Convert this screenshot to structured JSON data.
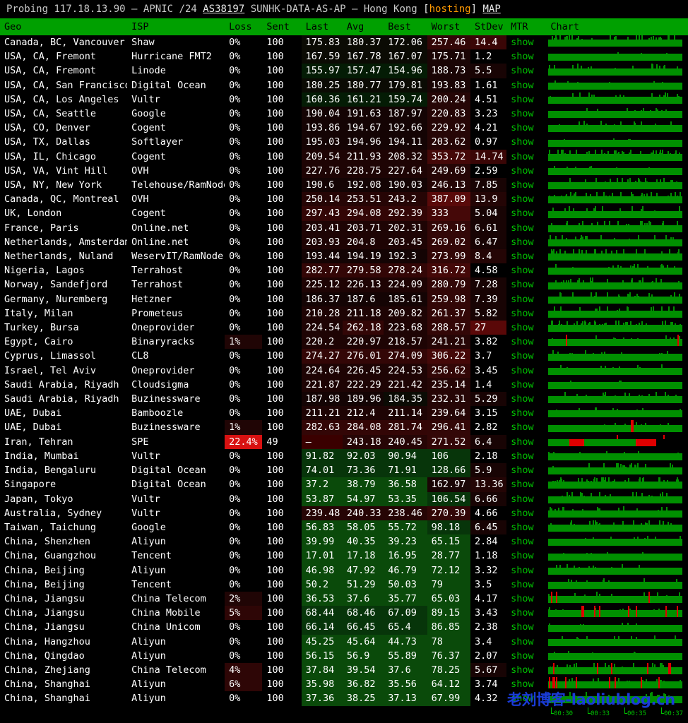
{
  "titlebar": {
    "probing_label": "Probing",
    "ip": "117.18.13.90",
    "dash1": "–",
    "registry": "APNIC",
    "prefix": "/24",
    "asn": "AS38197",
    "as_name": "SUNHK-DATA-AS-AP",
    "dash2": "–",
    "location": "Hong Kong",
    "bracket_open": "[",
    "hosting": "hosting",
    "bracket_close": "]",
    "map_link": "MAP",
    "hosting_color": "#ff9900",
    "link_color": "#e8e8e8"
  },
  "table": {
    "headers": [
      "Geo",
      "ISP",
      "Loss",
      "Sent",
      "Last",
      "Avg",
      "Best",
      "Worst",
      "StDev",
      "MTR",
      "Chart"
    ],
    "header_bg": "#00a000",
    "show_label": "show",
    "rows": [
      {
        "geo": "Canada, BC, Vancouver",
        "isp": "Shaw",
        "loss": "0%",
        "sent": "100",
        "last": "175.83",
        "avg": "180.37",
        "best": "172.06",
        "worst": "257.46",
        "stdev": "14.4",
        "mtr": "show"
      },
      {
        "geo": "USA, CA, Fremont",
        "isp": "Hurricane FMT2",
        "loss": "0%",
        "sent": "100",
        "last": "167.59",
        "avg": "167.78",
        "best": "167.07",
        "worst": "175.71",
        "stdev": "1.2",
        "mtr": "show"
      },
      {
        "geo": "USA, CA, Fremont",
        "isp": "Linode",
        "loss": "0%",
        "sent": "100",
        "last": "155.97",
        "avg": "157.47",
        "best": "154.96",
        "worst": "188.73",
        "stdev": "5.5",
        "mtr": "show"
      },
      {
        "geo": "USA, CA, San Francisco",
        "isp": "Digital Ocean",
        "loss": "0%",
        "sent": "100",
        "last": "180.25",
        "avg": "180.77",
        "best": "179.81",
        "worst": "193.83",
        "stdev": "1.61",
        "mtr": "show"
      },
      {
        "geo": "USA, CA, Los Angeles",
        "isp": "Vultr",
        "loss": "0%",
        "sent": "100",
        "last": "160.36",
        "avg": "161.21",
        "best": "159.74",
        "worst": "200.24",
        "stdev": "4.51",
        "mtr": "show"
      },
      {
        "geo": "USA, CA, Seattle",
        "isp": "Google",
        "loss": "0%",
        "sent": "100",
        "last": "190.04",
        "avg": "191.63",
        "best": "187.97",
        "worst": "220.83",
        "stdev": "3.23",
        "mtr": "show"
      },
      {
        "geo": "USA, CO, Denver",
        "isp": "Cogent",
        "loss": "0%",
        "sent": "100",
        "last": "193.86",
        "avg": "194.67",
        "best": "192.66",
        "worst": "229.92",
        "stdev": "4.21",
        "mtr": "show"
      },
      {
        "geo": "USA, TX, Dallas",
        "isp": "Softlayer",
        "loss": "0%",
        "sent": "100",
        "last": "195.03",
        "avg": "194.96",
        "best": "194.11",
        "worst": "203.62",
        "stdev": "0.97",
        "mtr": "show"
      },
      {
        "geo": "USA, IL, Chicago",
        "isp": "Cogent",
        "loss": "0%",
        "sent": "100",
        "last": "209.54",
        "avg": "211.93",
        "best": "208.32",
        "worst": "353.72",
        "stdev": "14.74",
        "mtr": "show"
      },
      {
        "geo": "USA, VA, Vint Hill",
        "isp": "OVH",
        "loss": "0%",
        "sent": "100",
        "last": "227.76",
        "avg": "228.75",
        "best": "227.64",
        "worst": "249.69",
        "stdev": "2.59",
        "mtr": "show"
      },
      {
        "geo": "USA, NY, New York",
        "isp": "Telehouse/RamNode",
        "loss": "0%",
        "sent": "100",
        "last": "190.6",
        "avg": "192.08",
        "best": "190.03",
        "worst": "246.13",
        "stdev": "7.85",
        "mtr": "show"
      },
      {
        "geo": "Canada, QC, Montreal",
        "isp": "OVH",
        "loss": "0%",
        "sent": "100",
        "last": "250.14",
        "avg": "253.51",
        "best": "243.2",
        "worst": "387.09",
        "stdev": "13.9",
        "mtr": "show"
      },
      {
        "geo": "UK, London",
        "isp": "Cogent",
        "loss": "0%",
        "sent": "100",
        "last": "297.43",
        "avg": "294.08",
        "best": "292.39",
        "worst": "333",
        "stdev": "5.04",
        "mtr": "show"
      },
      {
        "geo": "France, Paris",
        "isp": "Online.net",
        "loss": "0%",
        "sent": "100",
        "last": "203.41",
        "avg": "203.71",
        "best": "202.31",
        "worst": "269.16",
        "stdev": "6.61",
        "mtr": "show"
      },
      {
        "geo": "Netherlands, Amsterdam",
        "isp": "Online.net",
        "loss": "0%",
        "sent": "100",
        "last": "203.93",
        "avg": "204.8",
        "best": "203.45",
        "worst": "269.02",
        "stdev": "6.47",
        "mtr": "show"
      },
      {
        "geo": "Netherlands, Nuland",
        "isp": "WeservIT/RamNode",
        "loss": "0%",
        "sent": "100",
        "last": "193.44",
        "avg": "194.19",
        "best": "192.3",
        "worst": "273.99",
        "stdev": "8.4",
        "mtr": "show"
      },
      {
        "geo": "Nigeria, Lagos",
        "isp": "Terrahost",
        "loss": "0%",
        "sent": "100",
        "last": "282.77",
        "avg": "279.58",
        "best": "278.24",
        "worst": "316.72",
        "stdev": "4.58",
        "mtr": "show"
      },
      {
        "geo": "Norway, Sandefjord",
        "isp": "Terrahost",
        "loss": "0%",
        "sent": "100",
        "last": "225.12",
        "avg": "226.13",
        "best": "224.09",
        "worst": "280.79",
        "stdev": "7.28",
        "mtr": "show"
      },
      {
        "geo": "Germany, Nuremberg",
        "isp": "Hetzner",
        "loss": "0%",
        "sent": "100",
        "last": "186.37",
        "avg": "187.6",
        "best": "185.61",
        "worst": "259.98",
        "stdev": "7.39",
        "mtr": "show"
      },
      {
        "geo": "Italy, Milan",
        "isp": "Prometeus",
        "loss": "0%",
        "sent": "100",
        "last": "210.28",
        "avg": "211.18",
        "best": "209.82",
        "worst": "261.37",
        "stdev": "5.82",
        "mtr": "show"
      },
      {
        "geo": "Turkey, Bursa",
        "isp": "Oneprovider",
        "loss": "0%",
        "sent": "100",
        "last": "224.54",
        "avg": "262.18",
        "best": "223.68",
        "worst": "288.57",
        "stdev": "27",
        "mtr": "show"
      },
      {
        "geo": "Egypt, Cairo",
        "isp": "Binaryracks",
        "loss": "1%",
        "sent": "100",
        "last": "220.2",
        "avg": "220.97",
        "best": "218.57",
        "worst": "241.21",
        "stdev": "3.82",
        "mtr": "show"
      },
      {
        "geo": "Cyprus, Limassol",
        "isp": "CL8",
        "loss": "0%",
        "sent": "100",
        "last": "274.27",
        "avg": "276.01",
        "best": "274.09",
        "worst": "306.22",
        "stdev": "3.7",
        "mtr": "show"
      },
      {
        "geo": "Israel, Tel Aviv",
        "isp": "Oneprovider",
        "loss": "0%",
        "sent": "100",
        "last": "224.64",
        "avg": "226.45",
        "best": "224.53",
        "worst": "256.62",
        "stdev": "3.45",
        "mtr": "show"
      },
      {
        "geo": "Saudi Arabia, Riyadh",
        "isp": "Cloudsigma",
        "loss": "0%",
        "sent": "100",
        "last": "221.87",
        "avg": "222.29",
        "best": "221.42",
        "worst": "235.14",
        "stdev": "1.4",
        "mtr": "show"
      },
      {
        "geo": "Saudi Arabia, Riyadh",
        "isp": "Buzinessware",
        "loss": "0%",
        "sent": "100",
        "last": "187.98",
        "avg": "189.96",
        "best": "184.35",
        "worst": "232.31",
        "stdev": "5.29",
        "mtr": "show"
      },
      {
        "geo": "UAE, Dubai",
        "isp": "Bamboozle",
        "loss": "0%",
        "sent": "100",
        "last": "211.21",
        "avg": "212.4",
        "best": "211.14",
        "worst": "239.64",
        "stdev": "3.15",
        "mtr": "show"
      },
      {
        "geo": "UAE, Dubai",
        "isp": "Buzinessware",
        "loss": "1%",
        "sent": "100",
        "last": "282.63",
        "avg": "284.08",
        "best": "281.74",
        "worst": "296.41",
        "stdev": "2.82",
        "mtr": "show"
      },
      {
        "geo": "Iran, Tehran",
        "isp": "SPE",
        "loss": "22.4%",
        "sent": "49",
        "last": "–",
        "avg": "243.18",
        "best": "240.45",
        "worst": "271.52",
        "stdev": "6.4",
        "mtr": "show"
      },
      {
        "geo": "India, Mumbai",
        "isp": "Vultr",
        "loss": "0%",
        "sent": "100",
        "last": "91.82",
        "avg": "92.03",
        "best": "90.94",
        "worst": "106",
        "stdev": "2.18",
        "mtr": "show"
      },
      {
        "geo": "India, Bengaluru",
        "isp": "Digital Ocean",
        "loss": "0%",
        "sent": "100",
        "last": "74.01",
        "avg": "73.36",
        "best": "71.91",
        "worst": "128.66",
        "stdev": "5.9",
        "mtr": "show"
      },
      {
        "geo": "Singapore",
        "isp": "Digital Ocean",
        "loss": "0%",
        "sent": "100",
        "last": "37.2",
        "avg": "38.79",
        "best": "36.58",
        "worst": "162.97",
        "stdev": "13.36",
        "mtr": "show"
      },
      {
        "geo": "Japan, Tokyo",
        "isp": "Vultr",
        "loss": "0%",
        "sent": "100",
        "last": "53.87",
        "avg": "54.97",
        "best": "53.35",
        "worst": "106.54",
        "stdev": "6.66",
        "mtr": "show"
      },
      {
        "geo": "Australia, Sydney",
        "isp": "Vultr",
        "loss": "0%",
        "sent": "100",
        "last": "239.48",
        "avg": "240.33",
        "best": "238.46",
        "worst": "270.39",
        "stdev": "4.66",
        "mtr": "show"
      },
      {
        "geo": "Taiwan, Taichung",
        "isp": "Google",
        "loss": "0%",
        "sent": "100",
        "last": "56.83",
        "avg": "58.05",
        "best": "55.72",
        "worst": "98.18",
        "stdev": "6.45",
        "mtr": "show"
      },
      {
        "geo": "China, Shenzhen",
        "isp": "Aliyun",
        "loss": "0%",
        "sent": "100",
        "last": "39.99",
        "avg": "40.35",
        "best": "39.23",
        "worst": "65.15",
        "stdev": "2.84",
        "mtr": "show"
      },
      {
        "geo": "China, Guangzhou",
        "isp": "Tencent",
        "loss": "0%",
        "sent": "100",
        "last": "17.01",
        "avg": "17.18",
        "best": "16.95",
        "worst": "28.77",
        "stdev": "1.18",
        "mtr": "show"
      },
      {
        "geo": "China, Beijing",
        "isp": "Aliyun",
        "loss": "0%",
        "sent": "100",
        "last": "46.98",
        "avg": "47.92",
        "best": "46.79",
        "worst": "72.12",
        "stdev": "3.32",
        "mtr": "show"
      },
      {
        "geo": "China, Beijing",
        "isp": "Tencent",
        "loss": "0%",
        "sent": "100",
        "last": "50.2",
        "avg": "51.29",
        "best": "50.03",
        "worst": "79",
        "stdev": "3.5",
        "mtr": "show"
      },
      {
        "geo": "China, Jiangsu",
        "isp": "China Telecom",
        "loss": "2%",
        "sent": "100",
        "last": "36.53",
        "avg": "37.6",
        "best": "35.77",
        "worst": "65.03",
        "stdev": "4.17",
        "mtr": "show"
      },
      {
        "geo": "China, Jiangsu",
        "isp": "China Mobile",
        "loss": "5%",
        "sent": "100",
        "last": "68.44",
        "avg": "68.46",
        "best": "67.09",
        "worst": "89.15",
        "stdev": "3.43",
        "mtr": "show"
      },
      {
        "geo": "China, Jiangsu",
        "isp": "China Unicom",
        "loss": "0%",
        "sent": "100",
        "last": "66.14",
        "avg": "66.45",
        "best": "65.4",
        "worst": "86.85",
        "stdev": "2.38",
        "mtr": "show"
      },
      {
        "geo": "China, Hangzhou",
        "isp": "Aliyun",
        "loss": "0%",
        "sent": "100",
        "last": "45.25",
        "avg": "45.64",
        "best": "44.73",
        "worst": "78",
        "stdev": "3.4",
        "mtr": "show"
      },
      {
        "geo": "China, Qingdao",
        "isp": "Aliyun",
        "loss": "0%",
        "sent": "100",
        "last": "56.15",
        "avg": "56.9",
        "best": "55.89",
        "worst": "76.37",
        "stdev": "2.07",
        "mtr": "show"
      },
      {
        "geo": "China, Zhejiang",
        "isp": "China Telecom",
        "loss": "4%",
        "sent": "100",
        "last": "37.84",
        "avg": "39.54",
        "best": "37.6",
        "worst": "78.25",
        "stdev": "5.67",
        "mtr": "show"
      },
      {
        "geo": "China, Shanghai",
        "isp": "Aliyun",
        "loss": "6%",
        "sent": "100",
        "last": "35.98",
        "avg": "36.82",
        "best": "35.56",
        "worst": "64.12",
        "stdev": "3.74",
        "mtr": "show"
      },
      {
        "geo": "China, Shanghai",
        "isp": "Aliyun",
        "loss": "0%",
        "sent": "100",
        "last": "37.36",
        "avg": "38.25",
        "best": "37.13",
        "worst": "67.99",
        "stdev": "4.32",
        "mtr": "show"
      }
    ]
  },
  "chart_axis": {
    "ticks": [
      "00:30",
      "00:33",
      "00:35",
      "00:37"
    ]
  },
  "watermark": {
    "text": "老刘博客-laoliublog.cn",
    "color": "#1a3cd8"
  }
}
